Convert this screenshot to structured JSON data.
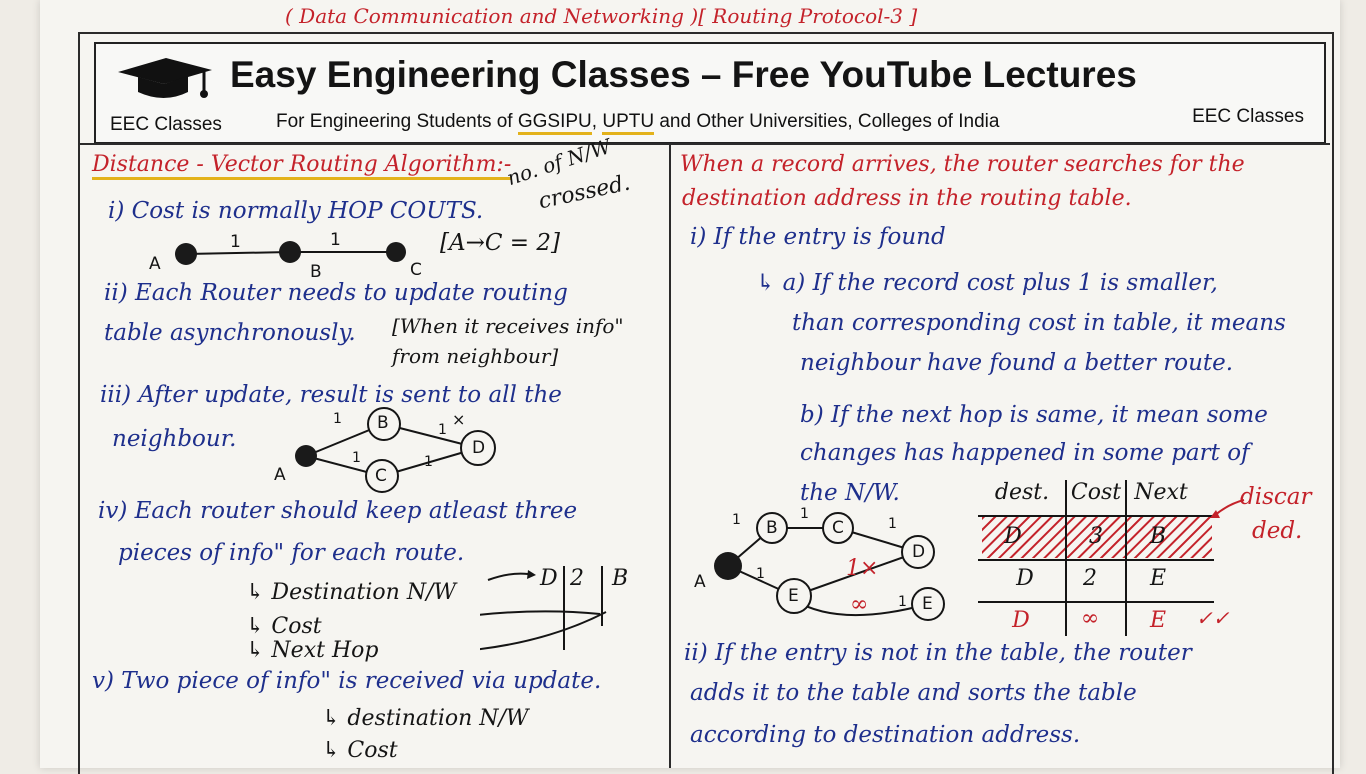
{
  "top_note": "( Data Communication and Networking )[ Routing Protocol-3 ]",
  "header": {
    "title": "Easy Engineering Classes – Free YouTube Lectures",
    "left_tag": "EEC Classes",
    "subtitle_pre": "For Engineering Students of ",
    "subtitle_u1": "GGSIPU",
    "subtitle_mid": ", ",
    "subtitle_u2": "UPTU",
    "subtitle_post": " and Other Universities, Colleges of India",
    "right_tag": "EEC Classes",
    "icon": "graduation-cap-icon"
  },
  "left": {
    "heading": "Distance - Vector Routing Algorithm:-",
    "side_note1": "no. of N/W",
    "side_note2": "crossed.",
    "p1": "i) Cost is normally HOP COUTS.",
    "p1_formula": "[A→C = 2]",
    "p1_nodes": [
      "A",
      "B",
      "C"
    ],
    "p1_edges": [
      "1",
      "1"
    ],
    "p2a": "ii) Each Router needs to update routing",
    "p2b": "table asynchronously.",
    "p2_note1": "[When it receives info\"",
    "p2_note2": "from neighbour]",
    "p3a": "iii) After update, result is sent to all the",
    "p3b": "neighbour.",
    "p3_nodes": [
      "A",
      "B",
      "C",
      "D"
    ],
    "p3_edges": [
      "1",
      "1",
      "1",
      "1",
      "×"
    ],
    "p4a": "iv) Each router should keep atleast three",
    "p4b": "pieces of info\" for each route.",
    "p4_items": [
      "↳ Destination N/W",
      "↳ Cost",
      "↳ Next Hop"
    ],
    "p4_example": [
      "D",
      "2",
      "B"
    ],
    "p5": "v) Two piece of info\" is received via update.",
    "p5_items": [
      "↳ destination N/W",
      "↳ Cost"
    ]
  },
  "right": {
    "intro1": "When a record arrives, the router searches for the",
    "intro2": "destination address in the routing table.",
    "r1": "i) If the entry is found",
    "r1a1": "↳ a) If the record cost plus 1 is smaller,",
    "r1a2": "than corresponding cost in table, it means",
    "r1a3": "neighbour have found a better route.",
    "r1b1": "b) If the next hop is same, it mean some",
    "r1b2": "changes has happened in some part of",
    "r1b3": "the N/W.",
    "diagram_nodes": [
      "A",
      "B",
      "C",
      "D",
      "E",
      "E"
    ],
    "diagram_edges": [
      "1",
      "1",
      "1",
      "1",
      "1",
      "1×",
      "∞",
      "1"
    ],
    "table_headers": [
      "dest.",
      "Cost",
      "Next"
    ],
    "table_rows": [
      [
        "D",
        "3",
        "B"
      ],
      [
        "D",
        "2",
        "E"
      ],
      [
        "D",
        "∞",
        "E"
      ]
    ],
    "discarded1": "discar",
    "discarded2": "ded.",
    "check_mark": "✓✓",
    "r2a": "ii) If the entry is not in the table, the router",
    "r2b": "adds it to the table and sorts the table",
    "r2c": "according to destination address."
  },
  "colors": {
    "blue_ink": "#1e2f8c",
    "red_ink": "#c4222a",
    "highlight": "#e3b21b"
  }
}
